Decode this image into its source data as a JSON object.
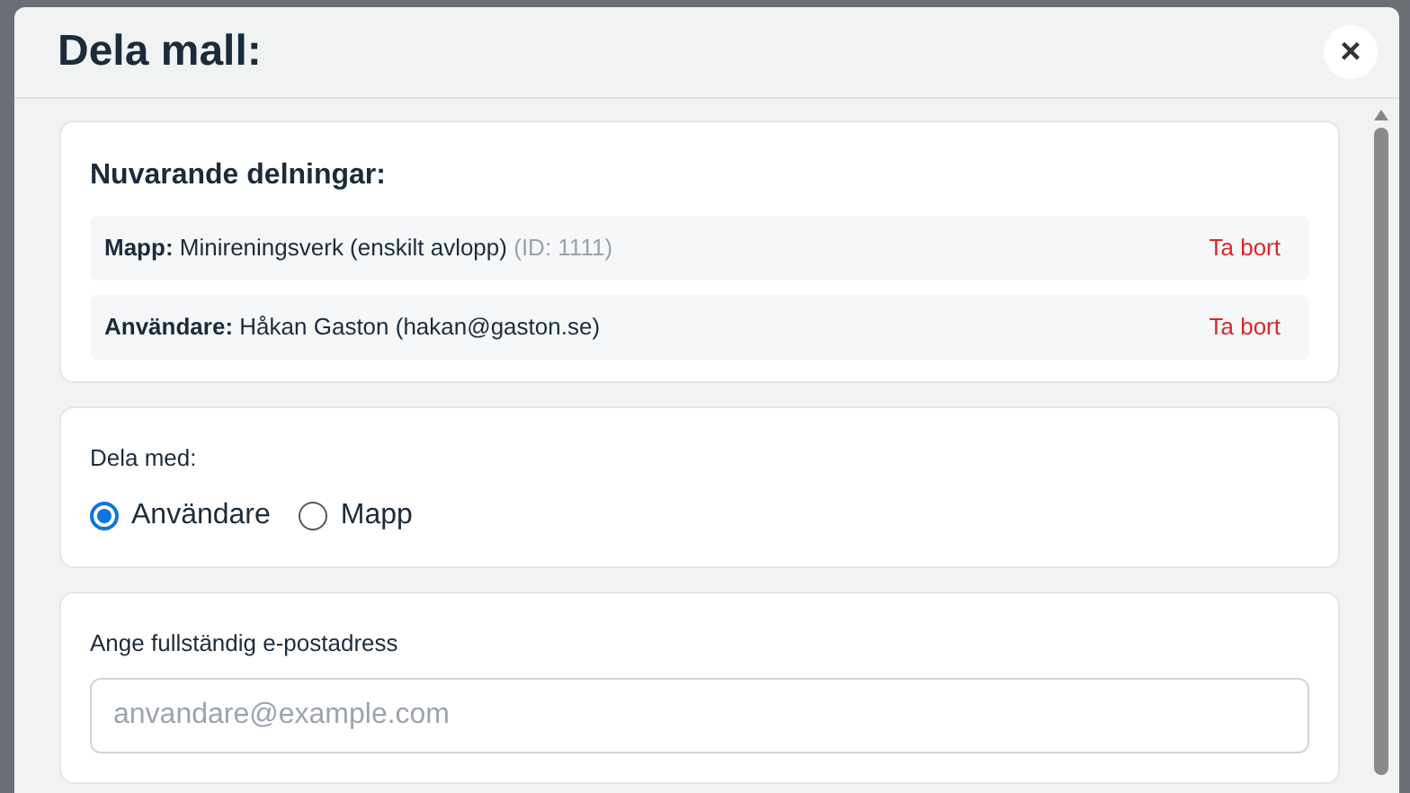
{
  "dialog": {
    "title": "Dela mall:",
    "close": "×"
  },
  "current_shares": {
    "heading": "Nuvarande delningar:",
    "items": [
      {
        "label": "Mapp:",
        "value": "Minireningsverk (enskilt avlopp)",
        "id": "(ID: 1111)",
        "action": "Ta bort"
      },
      {
        "label": "Användare:",
        "value": "Håkan Gaston (hakan@gaston.se)",
        "action": "Ta bort"
      }
    ]
  },
  "share_with": {
    "label": "Dela med:",
    "options": [
      {
        "label": "Användare",
        "selected": true
      },
      {
        "label": "Mapp",
        "selected": false
      }
    ]
  },
  "email": {
    "label": "Ange fullständig e-postadress",
    "placeholder": "anvandare@example.com"
  }
}
